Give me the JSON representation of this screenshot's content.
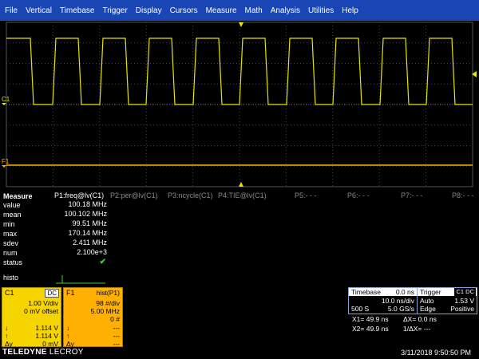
{
  "menu": [
    "File",
    "Vertical",
    "Timebase",
    "Trigger",
    "Display",
    "Cursors",
    "Measure",
    "Math",
    "Analysis",
    "Utilities",
    "Help"
  ],
  "grid_labels": {
    "c1": "C1",
    "f1": "F1"
  },
  "measure": {
    "header": "Measure",
    "params": [
      "P1:freq@lv(C1)",
      "P2:per@lv(C1)",
      "P3:ncycle(C1)",
      "P4:TIE@lv(C1)",
      "P5:- - -",
      "P6:- - -",
      "P7:- - -",
      "P8:- - -"
    ],
    "rows": [
      {
        "label": "value",
        "val": "100.18 MHz"
      },
      {
        "label": "mean",
        "val": "100.102 MHz"
      },
      {
        "label": "min",
        "val": "99.51 MHz"
      },
      {
        "label": "max",
        "val": "170.14 MHz"
      },
      {
        "label": "sdev",
        "val": "2.411 MHz"
      },
      {
        "label": "num",
        "val": "2.100e+3"
      },
      {
        "label": "status",
        "val": "✔"
      }
    ],
    "histo_label": "histo"
  },
  "c1": {
    "title": "C1",
    "tag": "DC",
    "vdiv": "1.00 V/div",
    "offset": "0 mV offset",
    "rows": [
      [
        "↓",
        "1.114 V"
      ],
      [
        "↑",
        "1.114 V"
      ],
      [
        "Δy",
        "0 mV"
      ]
    ]
  },
  "f1": {
    "title": "F1",
    "src": "hist(P1)",
    "hdiv": "98 #/div",
    "fdiv": "5.00 MHz",
    "count": "0 #",
    "rows": [
      [
        "↓",
        "---"
      ],
      [
        "↑",
        "---"
      ],
      [
        "Δy",
        "---"
      ]
    ]
  },
  "timebase": {
    "label": "Timebase",
    "delay": "0.0 ns",
    "tdiv": "10.0 ns/div",
    "samples": "500 S",
    "rate": "5.0 GS/s"
  },
  "trigger": {
    "label": "Trigger",
    "tag": "C1 DC",
    "mode": "Auto",
    "level": "1.53 V",
    "type": "Edge",
    "slope": "Positive"
  },
  "cursors": {
    "x1": "X1=  49.9 ns",
    "dx": "ΔX=  0.0 ns",
    "x2": "X2=  49.9 ns",
    "inv": "1/ΔX=     ---"
  },
  "brand": {
    "a": "TELEDYNE",
    "b": "LECROY"
  },
  "datetime": "3/11/2018 9:50:50 PM",
  "colors": {
    "menubar": "#1a46b5",
    "trace": "#e6e600",
    "c1": "#f6d400",
    "f1": "#ffb000"
  }
}
